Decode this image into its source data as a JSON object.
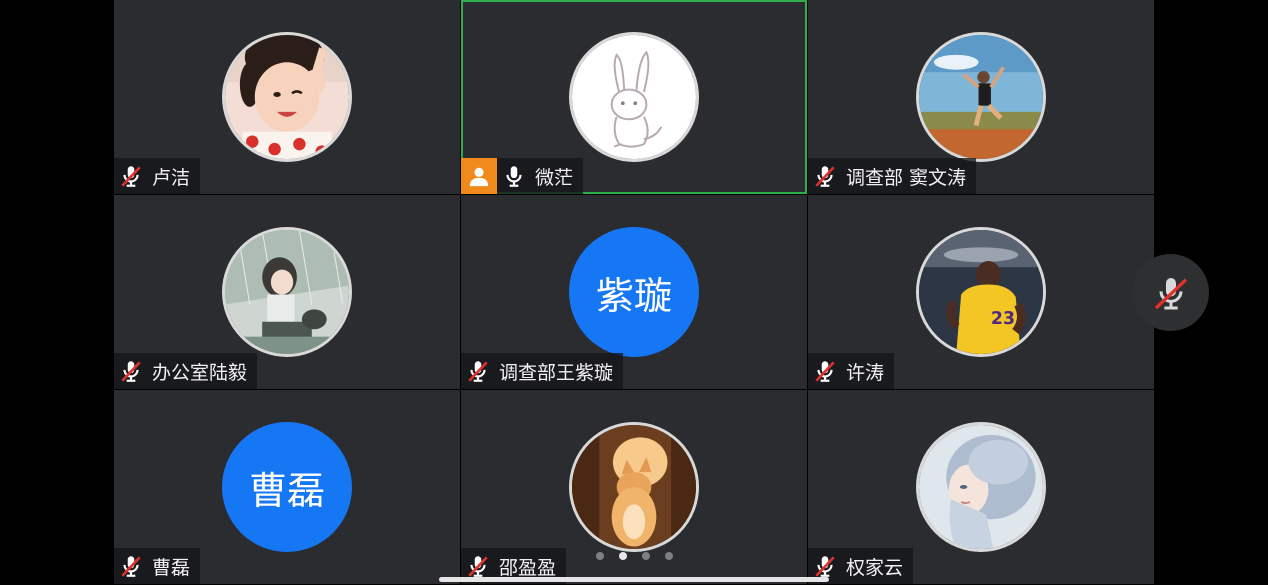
{
  "participants": [
    {
      "name": "卢洁",
      "avatar_text": "",
      "avatar_kind": "girl-photo",
      "mic": "muted"
    },
    {
      "name": "微茫",
      "avatar_text": "",
      "avatar_kind": "rabbit-sketch",
      "mic": "on",
      "host": true,
      "active_speaker": true
    },
    {
      "name": "调查部 窦文涛",
      "avatar_text": "",
      "avatar_kind": "jump-photo",
      "mic": "muted"
    },
    {
      "name": "办公室陆毅",
      "avatar_text": "",
      "avatar_kind": "anime-girl",
      "mic": "muted"
    },
    {
      "name": "调查部王紫璇",
      "avatar_text": "紫璇",
      "avatar_kind": "text",
      "mic": "muted"
    },
    {
      "name": "许涛",
      "avatar_text": "",
      "avatar_kind": "basketball-player",
      "mic": "muted"
    },
    {
      "name": "曹磊",
      "avatar_text": "曹磊",
      "avatar_kind": "text",
      "mic": "muted"
    },
    {
      "name": "邵盈盈",
      "avatar_text": "",
      "avatar_kind": "cat-photo",
      "mic": "muted"
    },
    {
      "name": "权家云",
      "avatar_text": "",
      "avatar_kind": "silver-hair-girl",
      "mic": "muted"
    }
  ],
  "pager": {
    "total": 4,
    "current": 2
  },
  "side_control": {
    "icon": "mic-muted-icon",
    "state": "muted"
  },
  "colors": {
    "tile_bg": "#2a2c2f",
    "active_border": "#2fae4f",
    "text_avatar_bg": "#1677f5",
    "host_badge": "#f08a1c",
    "mute_slash": "#e0312c"
  }
}
